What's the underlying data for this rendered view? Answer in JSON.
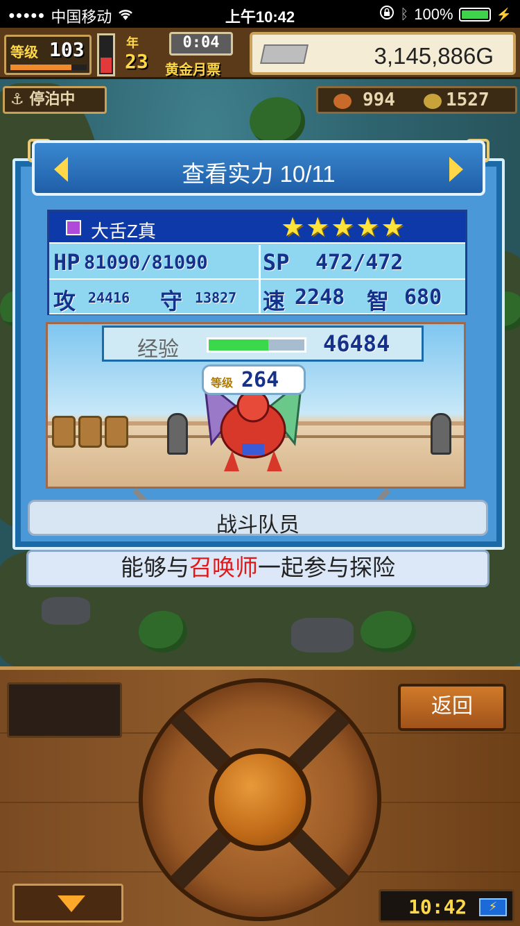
{
  "status_bar": {
    "signal": "●●●●●",
    "carrier": "中国移动",
    "time": "上午10:42",
    "battery_pct": "100%"
  },
  "hud": {
    "level_label": "等级",
    "level": "103",
    "month_label": "年",
    "month_num": "23",
    "clock": "0:04",
    "season": "黄金月票",
    "gold": "3,145,886G",
    "docked": "停泊中",
    "res_food": "994",
    "res_coin": "1527"
  },
  "dialog": {
    "title": "查看实力 10/11",
    "name": "大舌Z真",
    "stars": "★★★★★",
    "hp_label": "HP",
    "hp": "81090/81090",
    "sp_label": "SP",
    "sp": "472/472",
    "atk_label": "攻",
    "atk": "24416",
    "def_label": "守",
    "def": "13827",
    "spd_label": "速",
    "spd": "2248",
    "int_label": "智",
    "int": "680",
    "exp_label": "经验",
    "exp_value": "46484",
    "exp_fill": 0.62,
    "level_label": "等级",
    "level": "264",
    "role": "战斗队员"
  },
  "description": {
    "pre": "能够与",
    "highlight": "召唤师",
    "post": "一起参与探险"
  },
  "controller": {
    "back": "返回",
    "time": "10:42",
    "battery_icon": "⚡"
  },
  "colors": {
    "accent_blue": "#1a6aa8",
    "highlight_red": "#e01818",
    "gold": "#ffd84a"
  }
}
